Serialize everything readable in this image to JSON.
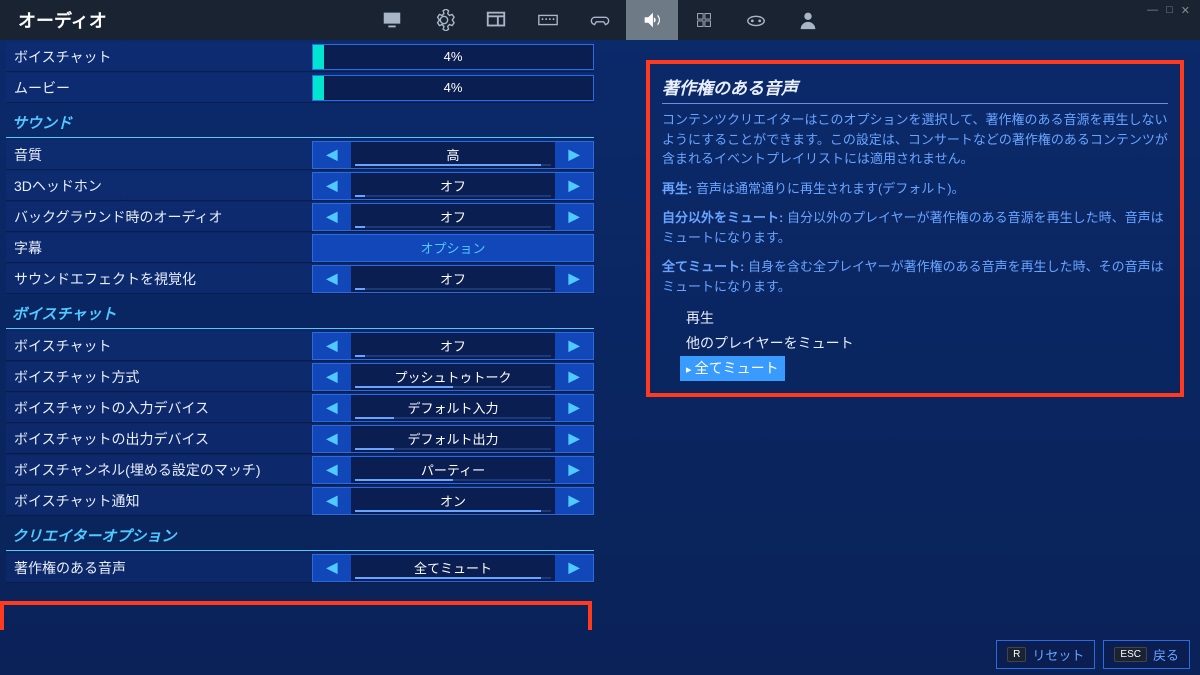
{
  "header": {
    "title": "オーディオ"
  },
  "tabs": [
    "monitor",
    "gear",
    "window",
    "keyboard",
    "gamepad",
    "audio",
    "access",
    "controller",
    "person"
  ],
  "sliders": [
    {
      "label": "ボイスチャット",
      "value": "4%",
      "pct": 4
    },
    {
      "label": "ムービー",
      "value": "4%",
      "pct": 4
    }
  ],
  "section_sound": {
    "title": "サウンド",
    "rows": [
      {
        "label": "音質",
        "value": "高",
        "bar": 95
      },
      {
        "label": "3Dヘッドホン",
        "value": "オフ",
        "bar": 5
      },
      {
        "label": "バックグラウンド時のオーディオ",
        "value": "オフ",
        "bar": 5
      },
      {
        "label": "字幕",
        "type": "button",
        "value": "オプション"
      },
      {
        "label": "サウンドエフェクトを視覚化",
        "value": "オフ",
        "bar": 5
      }
    ]
  },
  "section_voice": {
    "title": "ボイスチャット",
    "rows": [
      {
        "label": "ボイスチャット",
        "value": "オフ",
        "bar": 5
      },
      {
        "label": "ボイスチャット方式",
        "value": "プッシュトゥトーク",
        "bar": 50
      },
      {
        "label": "ボイスチャットの入力デバイス",
        "value": "デフォルト入力",
        "bar": 20
      },
      {
        "label": "ボイスチャットの出力デバイス",
        "value": "デフォルト出力",
        "bar": 20
      },
      {
        "label": "ボイスチャンネル(埋める設定のマッチ)",
        "value": "パーティー",
        "bar": 50
      },
      {
        "label": "ボイスチャット通知",
        "value": "オン",
        "bar": 95
      }
    ]
  },
  "section_creator": {
    "title": "クリエイターオプション",
    "rows": [
      {
        "label": "著作権のある音声",
        "value": "全てミュート",
        "bar": 95
      }
    ]
  },
  "info": {
    "title": "著作権のある音声",
    "p1": "コンテンツクリエイターはこのオプションを選択して、著作権のある音源を再生しないようにすることができます。この設定は、コンサートなどの著作権のあるコンテンツが含まれるイベントプレイリストには適用されません。",
    "p2a": "再生:",
    "p2b": " 音声は通常通りに再生されます(デフォルト)。",
    "p3a": "自分以外をミュート:",
    "p3b": " 自分以外のプレイヤーが著作権のある音源を再生した時、音声はミュートになります。",
    "p4a": "全てミュート:",
    "p4b": " 自身を含む全プレイヤーが著作権のある音声を再生した時、その音声はミュートになります。",
    "opts": [
      "再生",
      "他のプレイヤーをミュート",
      "全てミュート"
    ]
  },
  "footer": {
    "reset_key": "R",
    "reset": "リセット",
    "back_key": "ESC",
    "back": "戻る"
  }
}
